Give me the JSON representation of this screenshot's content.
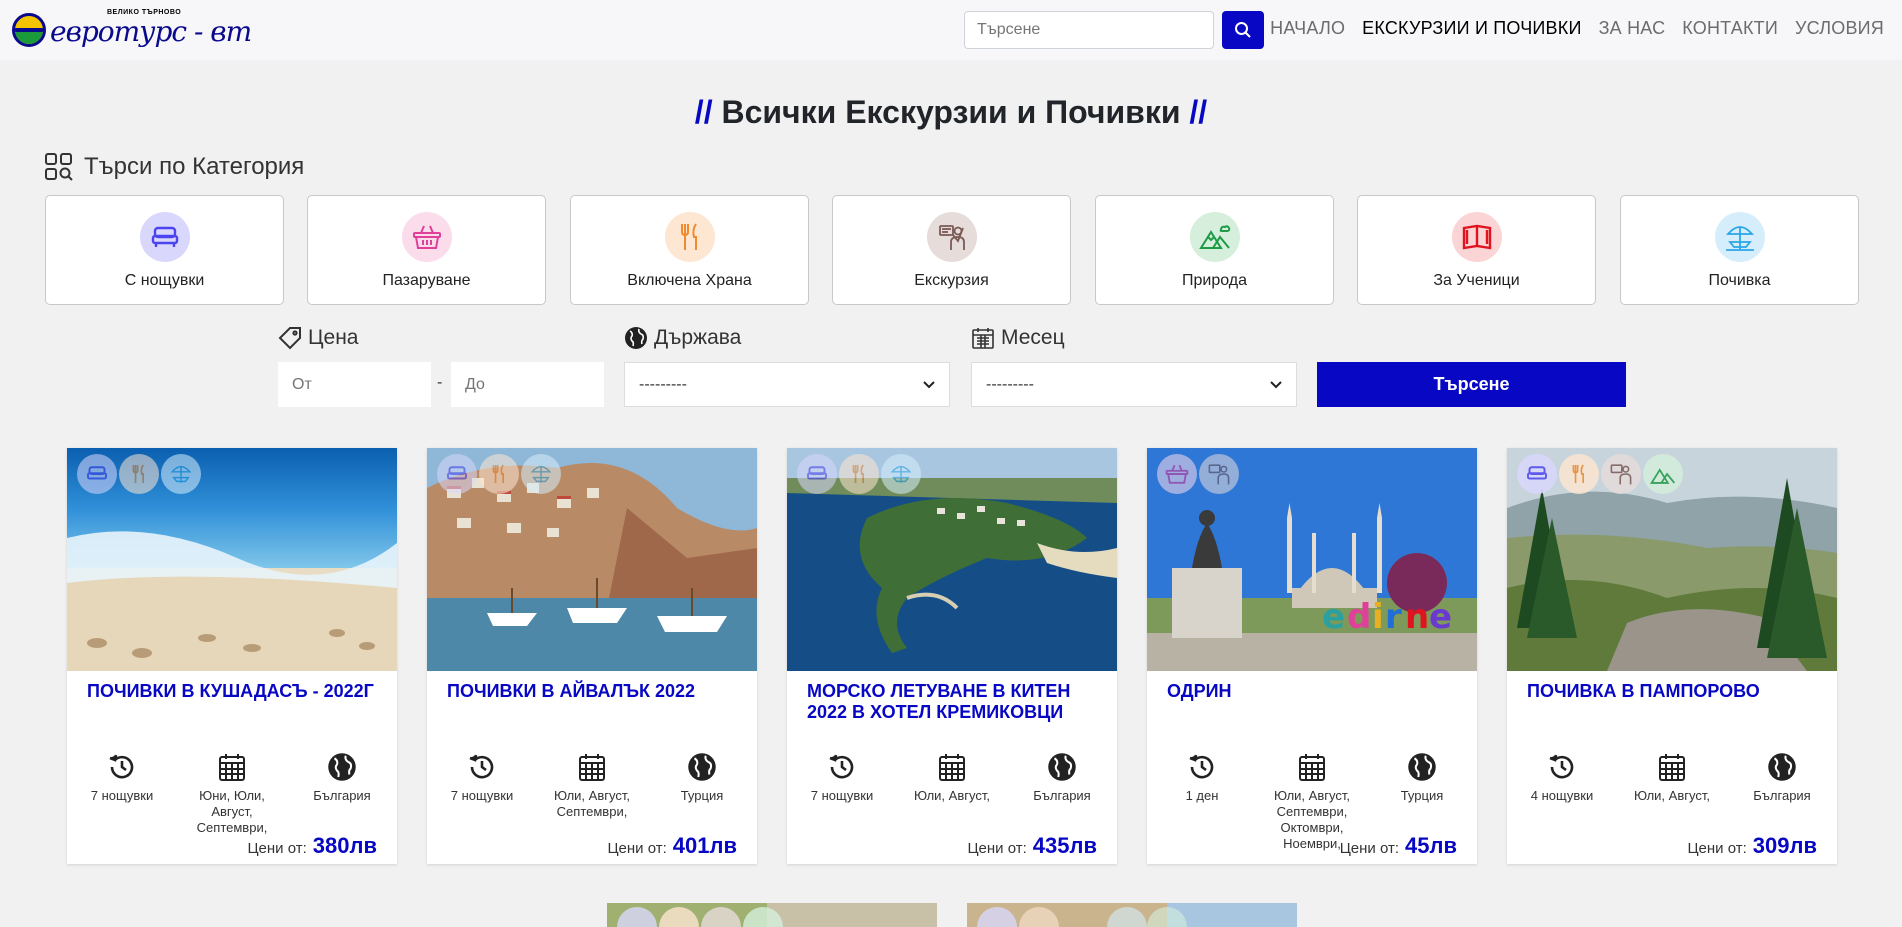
{
  "header": {
    "logo_text": "евротурс - вт",
    "logo_subtitle": "ВЕЛИКО ТЪРНОВО",
    "search_placeholder": "Търсене",
    "nav": [
      {
        "label": "НАЧАЛО"
      },
      {
        "label": "ЕКСКУРЗИИ И ПОЧИВКИ"
      },
      {
        "label": "ЗА НАС"
      },
      {
        "label": "КОНТАКТИ"
      },
      {
        "label": "УСЛОВИЯ"
      }
    ],
    "active_nav": "ЕКСКУРЗИИ И ПОЧИВКИ"
  },
  "page_title": {
    "prefix": "//",
    "text": "Всички Екскурзии и Почивки",
    "suffix": "//"
  },
  "category_heading": "Търси по Категория",
  "categories": [
    {
      "label": "С нощувки",
      "icon": "bed-icon",
      "color": "#4b44f0",
      "bg": "#d9d7fb"
    },
    {
      "label": "Пазаруване",
      "icon": "basket-icon",
      "color": "#e0409a",
      "bg": "#fbdceb"
    },
    {
      "label": "Включена Храна",
      "icon": "fork-knife-icon",
      "color": "#f08a2c",
      "bg": "#fde6d2"
    },
    {
      "label": "Екскурзия",
      "icon": "guide-icon",
      "color": "#7a5a55",
      "bg": "#e6dcda"
    },
    {
      "label": "Природа",
      "icon": "mountain-icon",
      "color": "#1f9a45",
      "bg": "#d5efdc"
    },
    {
      "label": "За Ученици",
      "icon": "book-icon",
      "color": "#e0141e",
      "bg": "#fbd4d6"
    },
    {
      "label": "Почивка",
      "icon": "beach-icon",
      "color": "#2aa6e8",
      "bg": "#d6eefb"
    }
  ],
  "filters": {
    "price_label": "Цена",
    "price_from_placeholder": "От",
    "price_separator": "-",
    "price_to_placeholder": "До",
    "country_label": "Държава",
    "country_value": "---------",
    "month_label": "Месец",
    "month_value": "---------",
    "submit_label": "Търсене"
  },
  "tours": [
    {
      "title": "ПОЧИВКИ В КУШАДАСЪ - 2022Г",
      "duration": "7 нощувки",
      "months": "Юни, Юли, Август, Септември,",
      "country": "България",
      "price_label": "Цени от:",
      "price": "380лв",
      "badges": [
        "bed-icon",
        "fork-knife-icon",
        "beach-icon"
      ]
    },
    {
      "title": "ПОЧИВКИ В АЙВАЛЪК 2022",
      "duration": "7 нощувки",
      "months": "Юли, Август, Септември,",
      "country": "Турция",
      "price_label": "Цени от:",
      "price": "401лв",
      "badges": [
        "bed-icon",
        "fork-knife-icon",
        "beach-icon"
      ]
    },
    {
      "title": "МОРСКО ЛЕТУВАНЕ В КИТЕН 2022 В ХОТЕЛ КРЕМИКОВЦИ",
      "duration": "7 нощувки",
      "months": "Юли, Август,",
      "country": "България",
      "price_label": "Цени от:",
      "price": "435лв",
      "badges": [
        "bed-icon",
        "fork-knife-icon",
        "beach-icon"
      ]
    },
    {
      "title": "ОДРИН",
      "duration": "1 ден",
      "months": "Юли, Август, Септември, Октомври, Ноември,",
      "country": "Турция",
      "price_label": "Цени от:",
      "price": "45лв",
      "badges": [
        "basket-icon",
        "guide-icon"
      ]
    },
    {
      "title": "ПОЧИВКА В ПАМПОРОВО",
      "duration": "4 нощувки",
      "months": "Юли, Август,",
      "country": "България",
      "price_label": "Цени от:",
      "price": "309лв",
      "badges": [
        "bed-icon",
        "fork-knife-icon",
        "guide-icon",
        "mountain-icon"
      ]
    }
  ],
  "colors": {
    "accent": "#0707c4",
    "background": "#f1f1f1"
  }
}
